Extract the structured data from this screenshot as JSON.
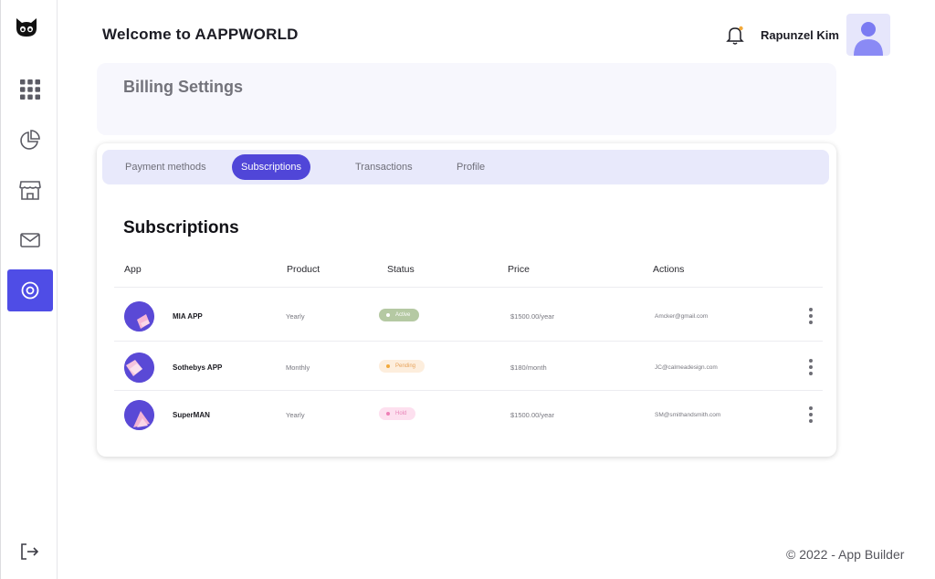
{
  "header": {
    "welcome": "Welcome to AAPPWORLD",
    "user_name": "Rapunzel Kim"
  },
  "billing": {
    "title": "Billing Settings"
  },
  "tabs": [
    {
      "label": "Payment methods",
      "active": false
    },
    {
      "label": "Subscriptions",
      "active": true
    },
    {
      "label": "Transactions",
      "active": false
    },
    {
      "label": "Profile",
      "active": false
    }
  ],
  "subscriptions": {
    "title": "Subscriptions",
    "columns": [
      "App",
      "Product",
      "Status",
      "Price",
      "Actions"
    ],
    "rows": [
      {
        "name": "MIA APP",
        "product": "Yearly",
        "status": "Active",
        "price": "$1500.00/year",
        "email": "Amcker@gmail.com"
      },
      {
        "name": "Sothebys APP",
        "product": "Monthly",
        "status": "Pending",
        "price": "$180/month",
        "email": "JC@calmeadesign.com"
      },
      {
        "name": "SuperMAN",
        "product": "Yearly",
        "status": "Hold",
        "price": "$1500.00/year",
        "email": "SM@smithandsmith.com"
      }
    ]
  },
  "footer": {
    "copyright": "© 2022 - App Builder"
  },
  "colors": {
    "accent": "#4f4de6",
    "tab_bg": "#e8e9fb",
    "active_badge": "#b5c9a3",
    "pending_badge": "#fdeedd",
    "hold_badge": "#fde0ef"
  },
  "icons": {
    "logo": "cat-face-icon",
    "nav": [
      "grid-icon",
      "pie-chart-icon",
      "store-icon",
      "mail-icon",
      "settings-circle-icon"
    ],
    "logout": "logout-icon",
    "bell": "bell-icon"
  }
}
